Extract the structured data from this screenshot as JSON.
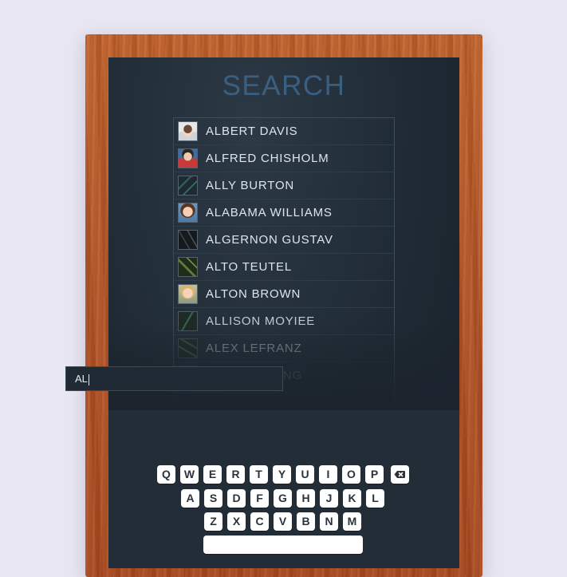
{
  "screen": {
    "title": "SEARCH"
  },
  "results": [
    {
      "name": "ALBERT DAVIS",
      "avatar": "child-portrait-icon"
    },
    {
      "name": "ALFRED CHISHOLM",
      "avatar": "child-portrait-icon"
    },
    {
      "name": "ALLY BURTON",
      "avatar": "leaf-pattern-icon"
    },
    {
      "name": "ALABAMA WILLIAMS",
      "avatar": "child-portrait-icon"
    },
    {
      "name": "ALGERNON GUSTAV",
      "avatar": "branch-pattern-icon"
    },
    {
      "name": "ALTO TEUTEL",
      "avatar": "leaf-pattern-icon"
    },
    {
      "name": "ALTON BROWN",
      "avatar": "child-portrait-icon"
    },
    {
      "name": "ALLISON MOYIEE",
      "avatar": "leaf-pattern-icon"
    },
    {
      "name": "ALEX LEFRANZ",
      "avatar": "leaf-pattern-icon"
    },
    {
      "name": "ALEC BALWING",
      "avatar": "leaf-pattern-icon"
    }
  ],
  "search": {
    "value": "AL"
  },
  "keyboard": {
    "row1": [
      "Q",
      "W",
      "E",
      "R",
      "T",
      "Y",
      "U",
      "I",
      "O",
      "P"
    ],
    "row2": [
      "A",
      "S",
      "D",
      "F",
      "G",
      "H",
      "J",
      "K",
      "L"
    ],
    "row3": [
      "Z",
      "X",
      "C",
      "V",
      "B",
      "N",
      "M"
    ],
    "backspace_icon": "backspace-icon",
    "space_label": ""
  }
}
